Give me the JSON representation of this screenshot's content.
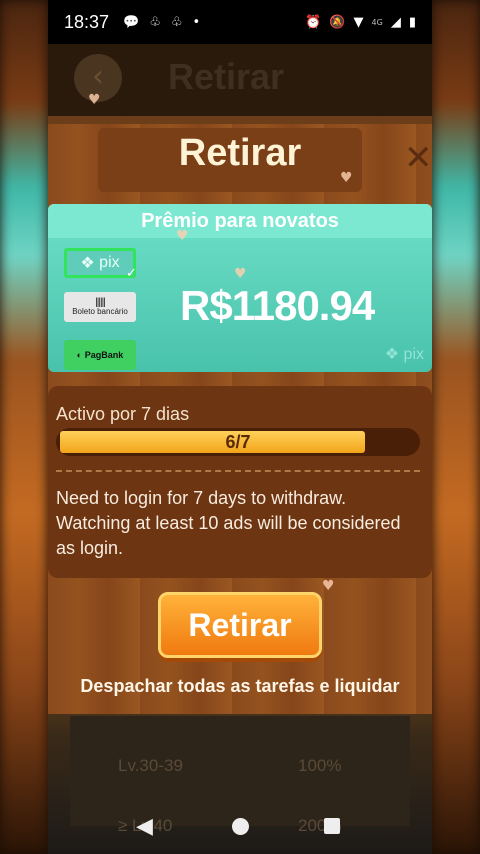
{
  "status_bar": {
    "time": "18:37",
    "left_icons": [
      "message-icon",
      "cat-icon",
      "cat-icon",
      "dot-icon"
    ],
    "network": "4G",
    "right_icons": [
      "alarm-icon",
      "mute-icon",
      "wifi-icon",
      "signal-icon",
      "battery-icon"
    ]
  },
  "background_screen": {
    "title": "Retirar",
    "table_rows": [
      {
        "level": "Lv.30-39",
        "value": "100%"
      },
      {
        "level": "≥ Lv.40",
        "value": "200%"
      }
    ]
  },
  "dialog": {
    "title": "Retirar",
    "reward": {
      "header": "Prêmio para novatos",
      "amount": "R$1180.94",
      "payment_methods": [
        {
          "label": "pix",
          "selected": true
        },
        {
          "label": "Boleto bancário",
          "selected": false
        },
        {
          "label": "PagBank",
          "selected": false
        }
      ],
      "watermark": "pix"
    },
    "activity": {
      "title": "Activo por 7 dias",
      "progress_label": "6/7",
      "progress_fraction": 0.857,
      "description": "Need to login for 7 days to withdraw. Watching at least 10 ads will be considered as login."
    },
    "withdraw_button": "Retirar",
    "footer_note": "Despachar todas as tarefas e liquidar"
  },
  "colors": {
    "teal": "#49c2ac",
    "orange_button": "#f07a10",
    "wood": "#8a4a1c",
    "progress": "#f2a41a"
  }
}
